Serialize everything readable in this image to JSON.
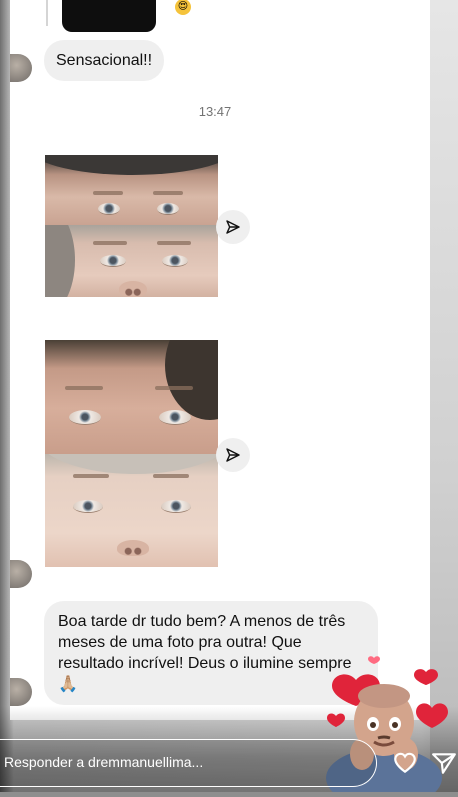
{
  "messages": [
    {
      "type": "text",
      "text": "Sensacional!!"
    },
    {
      "type": "timestamp",
      "text": "13:47"
    },
    {
      "type": "image",
      "description_icon": "photo"
    },
    {
      "type": "image",
      "description_icon": "photo"
    },
    {
      "type": "text",
      "text": "Boa tarde dr tudo bem? A menos de três  meses de uma foto pra outra! Que resultado  incrível! Deus o ilumine sempre 🙏🏼"
    }
  ],
  "reply": {
    "placeholder": "Responder a dremmanuellima..."
  },
  "icons": {
    "share": "paper-plane-icon",
    "like": "heart-outline-icon",
    "send": "paper-plane-icon"
  },
  "colors": {
    "bubble": "#efefef",
    "accent_heart": "#e0243a",
    "text": "#111111",
    "timestamp": "#737373"
  }
}
